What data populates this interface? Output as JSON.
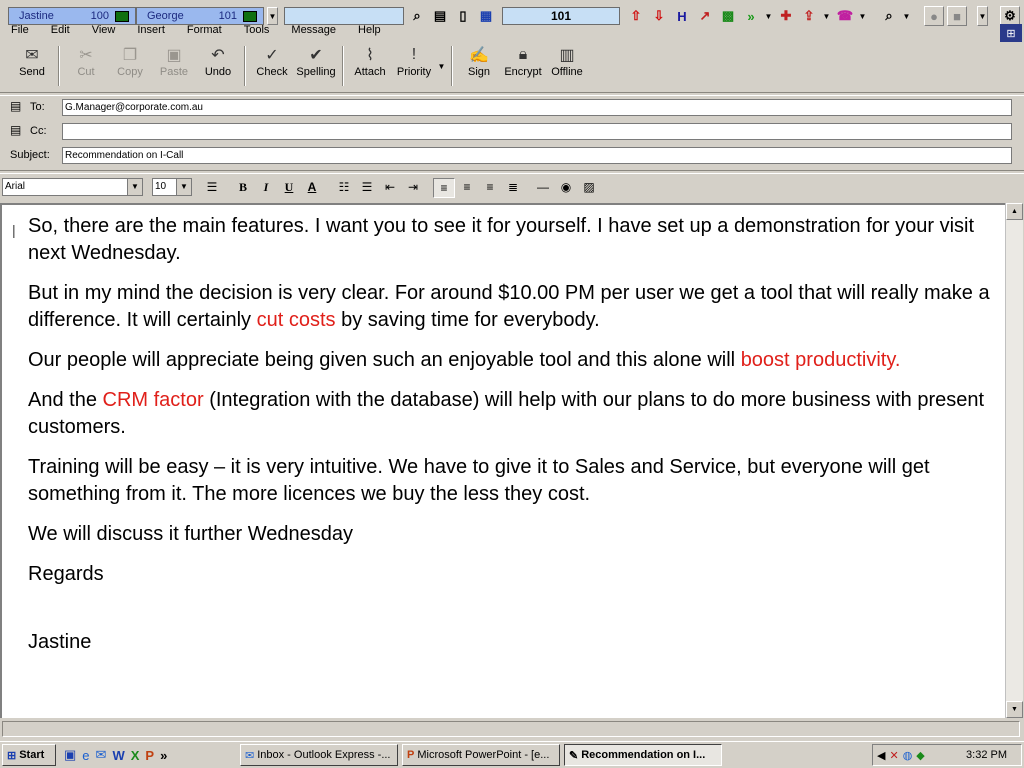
{
  "phonebar": {
    "ext1": {
      "name": "Jastine",
      "number": "100"
    },
    "ext2": {
      "name": "George",
      "number": "101"
    },
    "dial_display": "101"
  },
  "menu": [
    "File",
    "Edit",
    "View",
    "Insert",
    "Format",
    "Tools",
    "Message",
    "Help"
  ],
  "toolbar": {
    "send": "Send",
    "cut": "Cut",
    "copy": "Copy",
    "paste": "Paste",
    "undo": "Undo",
    "check": "Check",
    "spelling": "Spelling",
    "attach": "Attach",
    "priority": "Priority",
    "sign": "Sign",
    "encrypt": "Encrypt",
    "offline": "Offline"
  },
  "header": {
    "to_label": "To:",
    "to_value": "G.Manager@corporate.com.au",
    "cc_label": "Cc:",
    "cc_value": "",
    "subject_label": "Subject:",
    "subject_value": "Recommendation on I-Call"
  },
  "format": {
    "font": "Arial",
    "size": "10",
    "bold": "B",
    "italic": "I",
    "underline": "U",
    "color": "A"
  },
  "message": {
    "p1": "So, there are the main features. I want you to see it for yourself. I have set up a demonstration for your visit next Wednesday.",
    "p2a": "But in my mind the decision is very clear. For around $10.00 PM per user we get a tool that will really make a difference. It will certainly ",
    "p2red": "cut costs",
    "p2b": " by saving time for everybody.",
    "p3a": "Our people will appreciate being given such an enjoyable tool and this alone will ",
    "p3red": "boost productivity.",
    "p4a": "And the ",
    "p4red": "CRM factor",
    "p4b": " (Integration with the database) will help with our plans to do more business with present customers.",
    "p5": "Training will be easy – it is very intuitive. We have to give it to Sales and Service, but everyone will get something from it. The more licences we buy the less they cost.",
    "p6": "We will discuss it further Wednesday",
    "p7": "Regards",
    "p8": "Jastine"
  },
  "taskbar": {
    "start": "Start",
    "chevron": "»",
    "task1": "Inbox - Outlook Express -...",
    "task2": "Microsoft PowerPoint - [e...",
    "task3": "Recommendation on I...",
    "clock": "3:32 PM"
  },
  "colors": {
    "emphasis": "#e0201a",
    "window_face": "#d4d0c8",
    "ext_field": "#9ab8ee"
  }
}
